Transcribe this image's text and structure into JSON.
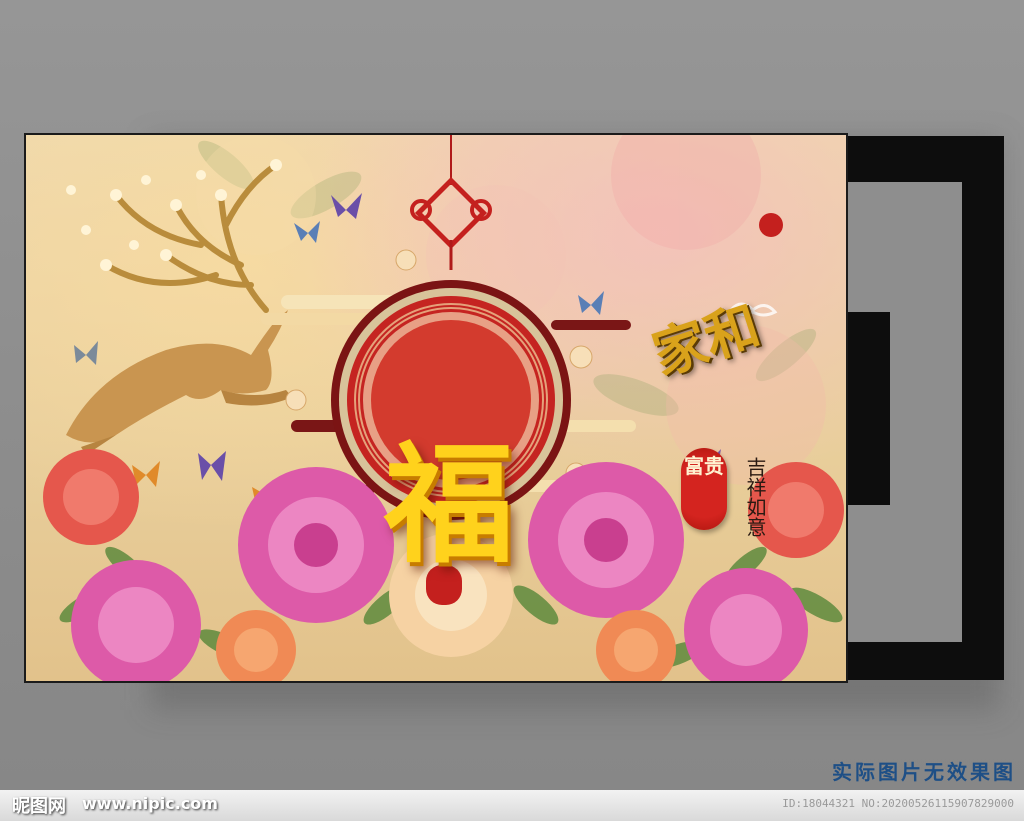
{
  "artwork": {
    "center_character": "福",
    "top_right_title": "家和",
    "seal_text": "富贵",
    "vertical_text": "吉祥如意"
  },
  "caption": "实际图片无效果图",
  "watermark": {
    "logo": "昵图网",
    "url": "www.nipic.com",
    "id_text": "ID:18044321 NO:20200526115907829000"
  },
  "colors": {
    "wall": "#8e8e8e",
    "frame": "#0d0d0d",
    "background": "#e9cf9c",
    "medallion_red": "#b8181a",
    "gold": "#ffd21c",
    "caption_blue": "#1e4f86"
  }
}
